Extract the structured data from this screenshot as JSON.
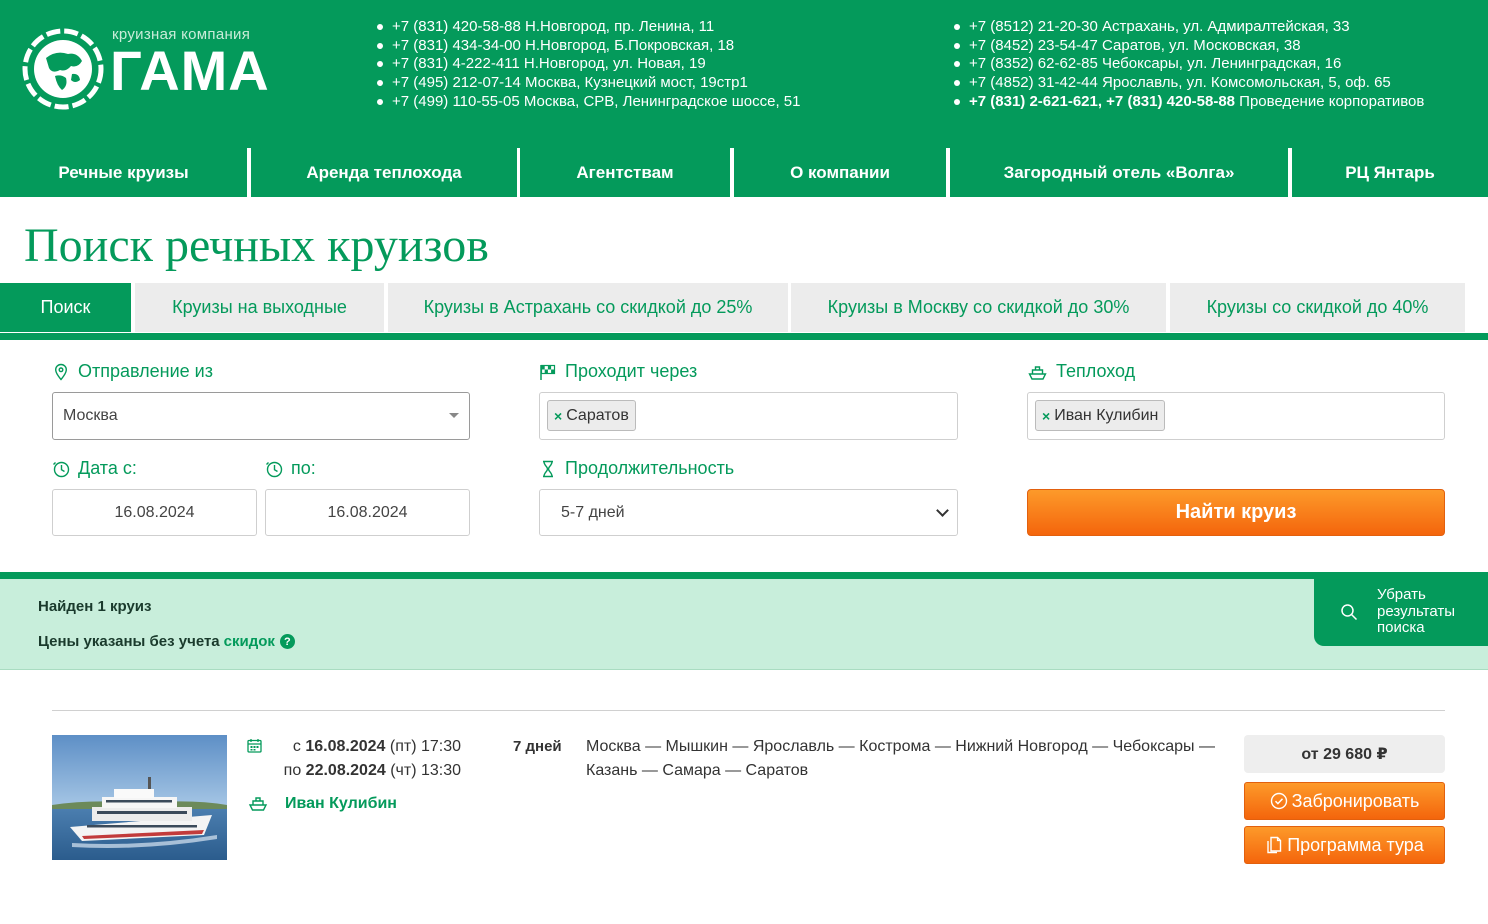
{
  "header": {
    "logo_small": "круизная компания",
    "logo_big": "ГАМА",
    "contacts_left": [
      "+7 (831) 420-58-88 Н.Новгород, пр. Ленина, 11",
      "+7 (831) 434-34-00 Н.Новгород, Б.Покровская, 18",
      "+7 (831) 4-222-411 Н.Новгород, ул. Новая, 19",
      "+7 (495) 212-07-14 Москва, Кузнецкий мост, 19стр1",
      "+7 (499) 110-55-05 Москва, СРВ, Ленинградское шоссе, 51"
    ],
    "contacts_right": [
      "+7 (8512) 21-20-30 Астрахань, ул. Адмиралтейская, 33",
      "+7 (8452) 23-54-47 Саратов, ул. Московская, 38",
      "+7 (8352) 62-62-85 Чебоксары, ул. Ленинградская, 16",
      "+7 (4852) 31-42-44 Ярославль, ул. Комсомольская, 5, оф. 65"
    ],
    "corporate_phones": "+7 (831) 2-621-621, +7 (831) 420-58-88",
    "corporate_text": " Проведение корпоративов"
  },
  "nav": [
    "Речные круизы",
    "Аренда теплохода",
    "Агентствам",
    "О компании",
    "Загородный отель «Волга»",
    "РЦ Янтарь"
  ],
  "page_title": "Поиск речных круизов",
  "tabs": [
    "Поиск",
    "Круизы на выходные",
    "Круизы в Астрахань со скидкой до 25%",
    "Круизы в Москву со скидкой до 30%",
    "Круизы со скидкой до 40%"
  ],
  "form": {
    "departure_label": "Отправление из",
    "departure_value": "Москва",
    "via_label": "Проходит через",
    "via_tag": "Саратов",
    "ship_label": "Теплоход",
    "ship_tag": "Иван Кулибин",
    "date_from_label": "Дата с:",
    "date_from": "16.08.2024",
    "date_to_label": "по:",
    "date_to": "16.08.2024",
    "duration_label": "Продолжительность",
    "duration_value": "5-7 дней",
    "search_button": "Найти круиз"
  },
  "results": {
    "found": "Найден 1 круиз",
    "prices_text": "Цены указаны без учета",
    "prices_link": "скидок",
    "clear_button": "Убрать результаты поиска"
  },
  "cruise": {
    "from_prefix": "с ",
    "from_date": "16.08.2024",
    "from_rest": " (пт) 17:30",
    "to_prefix": "по ",
    "to_date": "22.08.2024",
    "to_rest": " (чт) 13:30",
    "ship": "Иван Кулибин",
    "days": "7 дней",
    "route": "Москва — Мышкин — Ярославль — Кострома — Нижний Новгород — Чебоксары — Казань — Самара — Саратов",
    "price": "от 29 680 ₽",
    "book_button": "Забронировать",
    "program_button": "Программа тура"
  },
  "colors": {
    "brand_green": "#049a5b",
    "accent_orange": "#f4650c",
    "results_bg": "#c8eedb"
  }
}
